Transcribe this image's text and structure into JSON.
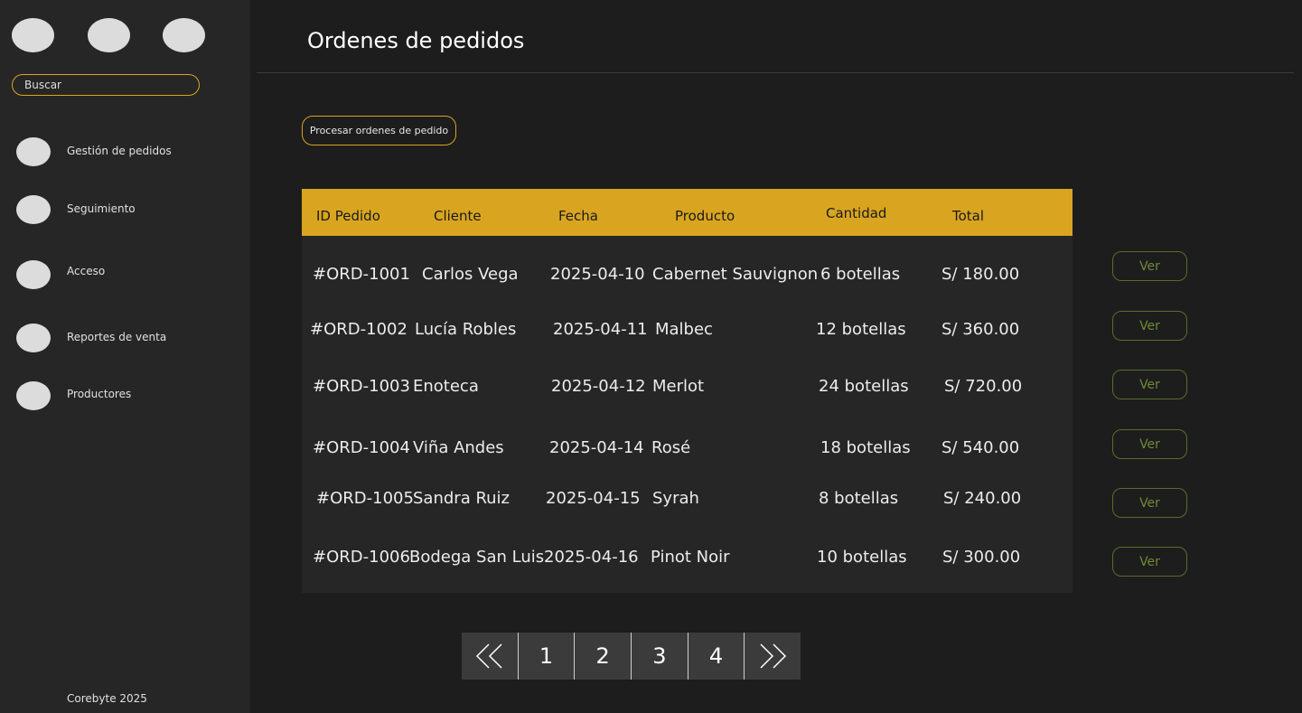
{
  "sidebar": {
    "search_placeholder": "Buscar",
    "items": [
      {
        "label": "Gestión de pedidos"
      },
      {
        "label": "Seguimiento"
      },
      {
        "label": "Acceso"
      },
      {
        "label": "Reportes de venta"
      },
      {
        "label": "Productores"
      }
    ],
    "footer": "Corebyte 2025"
  },
  "header": {
    "title": "Ordenes de pedidos"
  },
  "actions": {
    "process_label": "Procesar ordenes de pedido"
  },
  "table": {
    "headers": [
      "ID Pedido",
      "Cliente",
      "Fecha",
      "Producto",
      "Cantidad",
      "Total"
    ],
    "rows": [
      [
        "#ORD-1001",
        "Carlos Vega",
        "2025-04-10",
        "Cabernet Sauvignon",
        "6 botellas",
        "S/ 180.00"
      ],
      [
        "#ORD-1002",
        "Lucía Robles",
        "2025-04-11",
        "Malbec",
        "12 botellas",
        "S/ 360.00"
      ],
      [
        "#ORD-1003",
        "Enoteca",
        "2025-04-12",
        "Merlot",
        "24 botellas",
        "S/ 720.00"
      ],
      [
        "#ORD-1004",
        "Viña Andes",
        "2025-04-14",
        "Rosé",
        "18 botellas",
        "S/ 540.00"
      ],
      [
        "#ORD-1005",
        "Sandra Ruiz",
        "2025-04-15",
        "Syrah",
        "8 botellas",
        "S/ 240.00"
      ],
      [
        "#ORD-1006",
        "Bodega San Luis",
        "2025-04-16",
        "Pinot Noir",
        "10 botellas",
        "S/ 300.00"
      ]
    ],
    "view_label": "Ver"
  },
  "pagination": {
    "first_icon": "double-chevron-left-icon",
    "pages": [
      "1",
      "2",
      "3",
      "4"
    ],
    "last_icon": "double-chevron-right-icon"
  },
  "colors": {
    "accent": "#d9a520",
    "background": "#1d1d1d",
    "sidebar": "#262626",
    "view_button": "#6e8a35"
  }
}
